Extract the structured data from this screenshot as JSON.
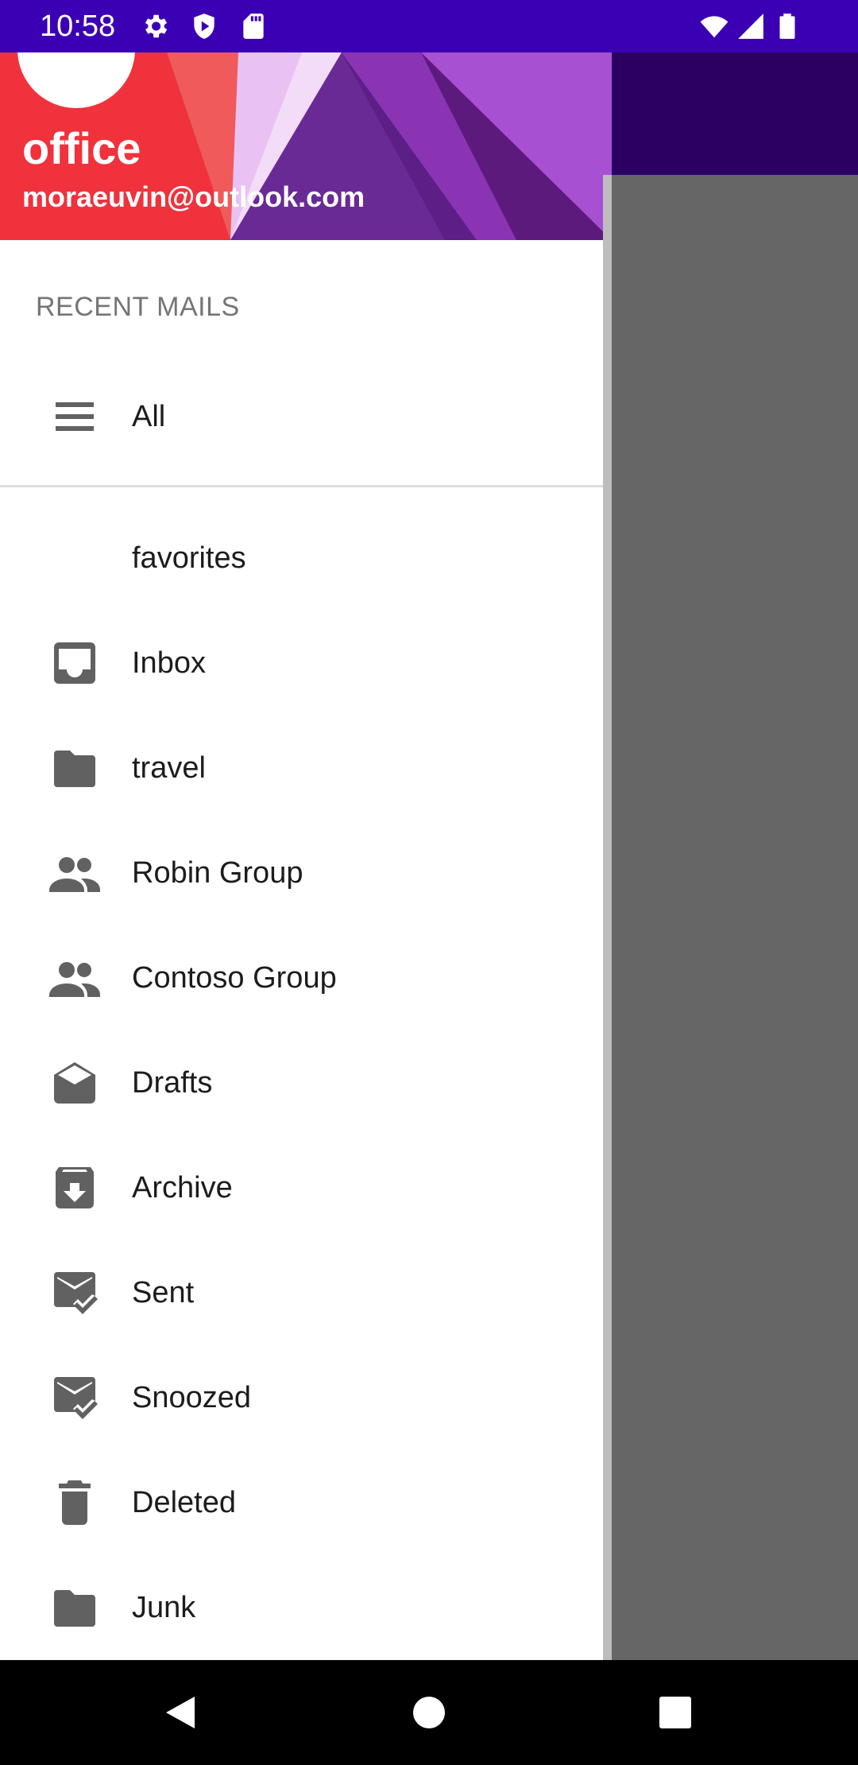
{
  "status_bar": {
    "time": "10:58",
    "icons": [
      "settings-icon",
      "play-protect-icon",
      "sd-card-icon",
      "wifi-icon",
      "signal-icon",
      "battery-icon"
    ]
  },
  "drawer": {
    "header": {
      "account_name": "office",
      "account_email": "moraeuvin@outlook.com"
    },
    "section_title": "RECENT MAILS",
    "all_item": {
      "label": "All",
      "icon": "menu-lines-icon"
    },
    "favorites_header": "favorites",
    "items": [
      {
        "label": "Inbox",
        "icon": "inbox-icon"
      },
      {
        "label": "travel",
        "icon": "folder-icon"
      },
      {
        "label": "Robin Group",
        "icon": "group-icon"
      },
      {
        "label": "Contoso Group",
        "icon": "group-icon"
      },
      {
        "label": "Drafts",
        "icon": "drafts-icon"
      },
      {
        "label": "Archive",
        "icon": "archive-icon"
      },
      {
        "label": "Sent",
        "icon": "mail-check-icon"
      },
      {
        "label": "Snoozed",
        "icon": "mail-check-icon"
      },
      {
        "label": "Deleted",
        "icon": "trash-icon"
      },
      {
        "label": "Junk",
        "icon": "folder-icon"
      }
    ]
  },
  "colors": {
    "status_bar": "#3c00b4",
    "app_toolbar": "#2a0063",
    "scrim": "#666666",
    "icon": "#616161",
    "text": "#1c1c1c",
    "section_title": "#757575"
  },
  "nav_bar": {
    "buttons": [
      "back-icon",
      "home-icon",
      "recents-icon"
    ]
  }
}
